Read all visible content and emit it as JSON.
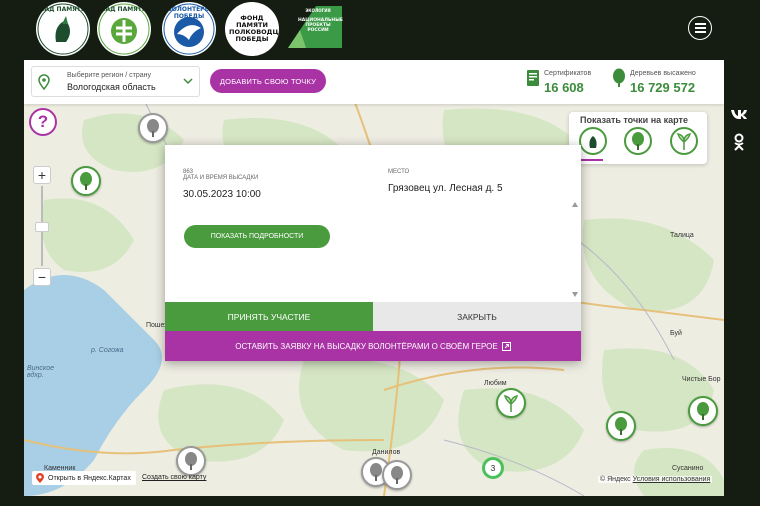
{
  "header": {
    "logos": [
      {
        "name": "САД ПАМЯТИ"
      },
      {
        "name": "САД ПАМЯТИ"
      },
      {
        "name": "ВОЛОНТЕРЫ ПОБЕДЫ"
      },
      {
        "name": "ФОНД ПАМЯТИ ПОЛКОВОДЦЕВ ПОБЕДЫ"
      },
      {
        "name": "НАЦИОНАЛЬНЫЕ ПРОЕКТЫ РОССИИ",
        "tag": "ЭКОЛОГИЯ"
      }
    ],
    "menu_icon": "hamburger-icon"
  },
  "controls": {
    "region_label": "Выберите регион / страну",
    "region_value": "Вологодская область",
    "add_point": "ДОБАВИТЬ СВОЮ ТОЧКУ",
    "certificates_label": "Сертификатов",
    "certificates_value": "16 608",
    "trees_label": "Деревьев высажено",
    "trees_value": "16 729 572"
  },
  "map": {
    "show_points_title": "Показать точки на карте",
    "help": "?",
    "zoom_in": "+",
    "zoom_out": "−",
    "cluster_count": "3",
    "labels": [
      "Пошех",
      "Талица",
      "Буй",
      "Чистые Бор",
      "Любим",
      "Данилов",
      "Сусанино",
      "Каменник",
      "р. Согожа",
      "Винское вдхр."
    ],
    "open_yandex": "Открыть в Яндекс.Картах",
    "create_map": "Создать свою карту",
    "copyright": "© Яндекс",
    "terms": "Условия использования"
  },
  "popup": {
    "id": "863",
    "date_label": "ДАТА И ВРЕМЯ ВЫСАДКИ",
    "date_value": "30.05.2023 10:00",
    "place_label": "МЕСТО",
    "place_value": "Грязовец ул. Лесная д. 5",
    "details": "ПОКАЗАТЬ ПОДРОБНОСТИ",
    "participate": "ПРИНЯТЬ УЧАСТИЕ",
    "close": "ЗАКРЫТЬ",
    "apply": "ОСТАВИТЬ ЗАЯВКУ НА ВЫСАДКУ ВОЛОНТЁРАМИ О СВОЁМ ГЕРОЕ"
  },
  "colors": {
    "accent_green": "#4a9a3e",
    "accent_purple": "#a932a4",
    "stat_green": "#3c8c3c"
  },
  "social": [
    "vk-icon",
    "odnoklassniki-icon"
  ]
}
